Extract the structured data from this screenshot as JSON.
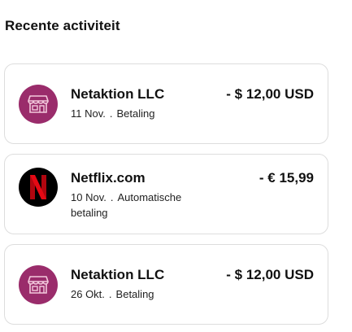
{
  "section": {
    "title": "Recente activiteit"
  },
  "colors": {
    "store_avatar_bg": "#9a2c6b",
    "netflix_avatar_bg": "#000000",
    "netflix_red": "#e50914"
  },
  "activities": [
    {
      "merchant": "Netaktion LLC",
      "date": "11 Nov.",
      "separator": ".",
      "type": "Betaling",
      "amount": "- $ 12,00 USD",
      "icon": "store-icon"
    },
    {
      "merchant": "Netflix.com",
      "date": "10 Nov.",
      "separator": ".",
      "type": "Automatische betaling",
      "amount": "- € 15,99",
      "icon": "netflix-logo-icon"
    },
    {
      "merchant": "Netaktion LLC",
      "date": "26 Okt.",
      "separator": ".",
      "type": "Betaling",
      "amount": "- $ 12,00 USD",
      "icon": "store-icon"
    }
  ]
}
